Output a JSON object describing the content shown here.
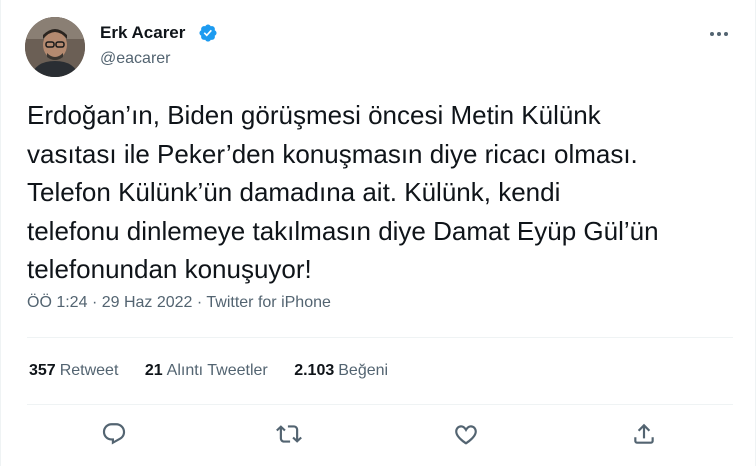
{
  "author": {
    "display_name": "Erk Acarer",
    "handle": "@eacarer",
    "verified_icon": "verified-badge-icon",
    "accent_color": "#1d9bf0"
  },
  "tweet": {
    "text_lines": [
      "Erdoğan’ın, Biden görüşmesi öncesi Metin Külünk",
      "vasıtası ile Peker’den konuşmasın diye ricacı olması.",
      "Telefon Külünk’ün damadına ait. Külünk, kendi",
      "telefonu dinlemeye takılmasın diye Damat Eyüp Gül’ün",
      "telefonundan konuşuyor!"
    ],
    "time": "ÖÖ 1:24",
    "separator": "·",
    "date": "29 Haz 2022",
    "source": "Twitter for iPhone"
  },
  "stats": {
    "retweets_count": "357",
    "retweets_label": "Retweet",
    "quotes_count": "21",
    "quotes_label": "Alıntı Tweetler",
    "likes_count": "2.103",
    "likes_label": "Beğeni"
  },
  "actions": {
    "reply_icon": "reply-icon",
    "retweet_icon": "retweet-icon",
    "like_icon": "heart-icon",
    "share_icon": "share-icon",
    "more_icon": "more-options-icon"
  },
  "colors": {
    "text": "#0f1419",
    "secondary": "#536471",
    "divider": "#eff3f4"
  }
}
